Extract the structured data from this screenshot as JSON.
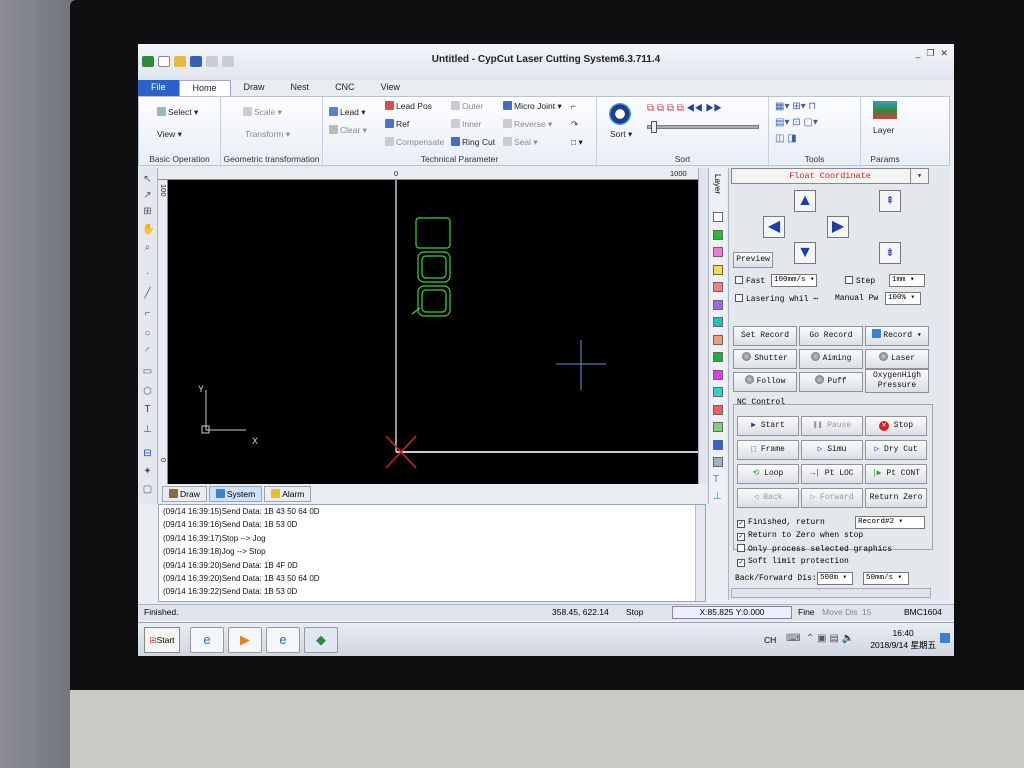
{
  "window": {
    "title": "Untitled - CypCut Laser Cutting System6.3.711.4",
    "controls": [
      "_",
      "❐",
      "✕"
    ]
  },
  "tabs": [
    "File",
    "Home",
    "Draw",
    "Nest",
    "CNC",
    "View"
  ],
  "ribbon": {
    "basic": {
      "label": "Basic Operation",
      "select": "Select",
      "view": "View"
    },
    "geo": {
      "label": "Geometric transformation",
      "scale": "Scale",
      "transform": "Transform"
    },
    "tech": {
      "label": "Technical Parameter",
      "lead": "Lead",
      "clear": "Clear",
      "lead_pos": "Lead Pos",
      "ref": "Ref",
      "compensate": "Compensate",
      "outer": "Outer",
      "inner": "Inner",
      "ring_cut": "Ring Cut",
      "micro_joint": "Micro Joint",
      "reverse": "Reverse",
      "seal": "Seal"
    },
    "sort": {
      "label": "Sort",
      "button": "Sort"
    },
    "tools": {
      "label": "Tools"
    },
    "params": {
      "label": "Params",
      "layer": "Layer"
    }
  },
  "canvas": {
    "ruler_top": [
      "0",
      "1000"
    ],
    "ruler_left": [
      "100",
      "0"
    ],
    "axis_x": "X",
    "axis_y": "Y"
  },
  "layer_panel": {
    "title": "Layer",
    "colors": [
      "#ffffff",
      "#22c02a",
      "#f07ad8",
      "#f0e040",
      "#f08080",
      "#9a6ae8",
      "#20c0c0",
      "#f0a070",
      "#20b040",
      "#e040e0",
      "#30d0d0",
      "#f06060",
      "#80d080",
      "#3060e0",
      "#a0b0c8"
    ]
  },
  "control_panel": {
    "coord_mode": "Float Coordinate",
    "preview": "Preview",
    "fast_label": "Fast",
    "fast_value": "100mm/s",
    "step_label": "Step",
    "step_value": "1mm",
    "lasering_label": "Lasering whil",
    "manual_pw_label": "Manual Pw",
    "manual_pw_value": "100%",
    "set_record": "Set Record",
    "go_record": "Go Record",
    "record": "Record",
    "shutter": "Shutter",
    "aiming": "Aiming",
    "laser": "Laser",
    "follow": "Follow",
    "puff": "Puff",
    "oxygen": "OxygenHigh Pressure",
    "nc_control": "NC Control",
    "start": "Start",
    "pause": "Pause",
    "stop": "Stop",
    "frame": "Frame",
    "simu": "Simu",
    "dry_cut": "Dry Cut",
    "loop": "Loop",
    "pt_loc": "Pt LOC",
    "pt_cont": "Pt CONT",
    "back": "Back",
    "forward": "Forward",
    "return_zero": "Return Zero",
    "finished_return": "Finished, return",
    "finished_target": "Record#2",
    "return_zero_stop": "Return to Zero when stop",
    "only_selected": "Only process selected graphics",
    "soft_limit": "Soft limit protection",
    "back_forward_dis": "Back/Forward Dis:",
    "dis_value": "500m",
    "speed_value": "50mm/s"
  },
  "bottom_tabs": [
    "Draw",
    "System",
    "Alarm"
  ],
  "log": [
    "(09/14 16:39:15)Send Data: 1B 43 50 64 0D",
    "(09/14 16:39:16)Send Data: 1B 53 0D",
    "(09/14 16:39:17)Stop --> Jog",
    "(09/14 16:39:18)Jog --> Stop",
    "(09/14 16:39:20)Send Data: 1B 4F 0D",
    "(09/14 16:39:20)Send Data: 1B 43 50 64 0D",
    "(09/14 16:39:22)Send Data: 1B 53 0D"
  ],
  "status": {
    "message": "Finished.",
    "cursor": "358.45, 622.14",
    "state": "Stop",
    "position": "X:85.825 Y:0.000",
    "fine": "Fine",
    "move_dis": "Move Dis",
    "move_val": "15",
    "card": "BMC1604"
  },
  "taskbar": {
    "start": "Start",
    "lang": "CH",
    "time": "16:40",
    "date": "2018/9/14 星期五"
  }
}
